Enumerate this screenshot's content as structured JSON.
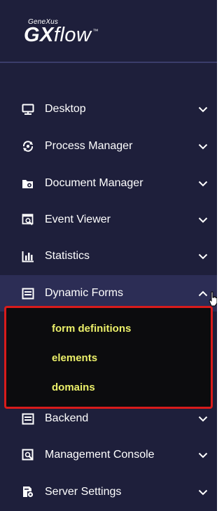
{
  "brand": {
    "small": "GeneXus",
    "gx": "GX",
    "flow": "flow",
    "tm": "™"
  },
  "nav": {
    "desktop": "Desktop",
    "process_manager": "Process Manager",
    "document_manager": "Document Manager",
    "event_viewer": "Event Viewer",
    "statistics": "Statistics",
    "dynamic_forms": "Dynamic Forms",
    "backend": "Backend",
    "management_console": "Management Console",
    "server_settings": "Server Settings"
  },
  "submenu": {
    "form_definitions": "form definitions",
    "elements": "elements",
    "domains": "domains"
  },
  "colors": {
    "sidebar_bg": "#1e1f3b",
    "active_bg": "#2c2d55",
    "submenu_bg": "#0c0c0e",
    "highlight_border": "#d81b1b",
    "submenu_text": "#ecf06a"
  },
  "expanded_item": "dynamic_forms"
}
